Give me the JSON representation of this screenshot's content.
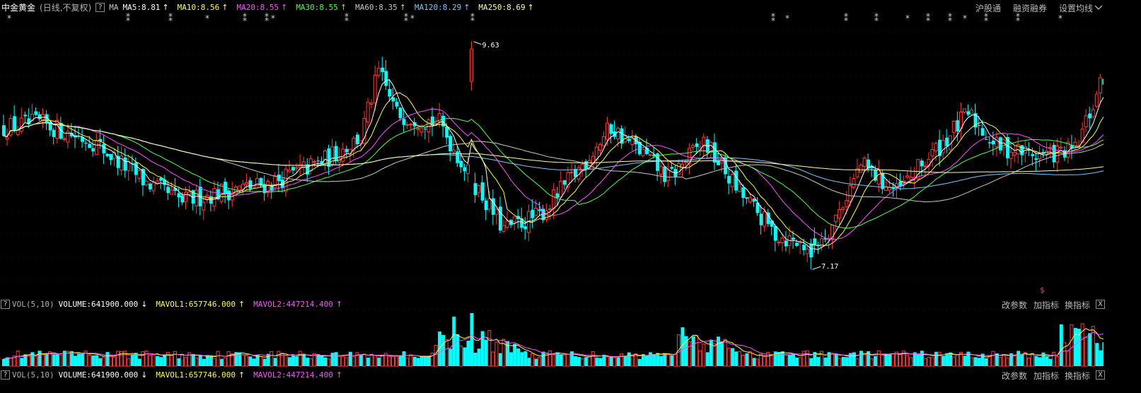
{
  "header": {
    "stock_name": "中金黄金",
    "period_info": "(日线,不复权)",
    "help_label": "?",
    "indicator": "MA",
    "ma_items": [
      {
        "label": "MA5:8.81",
        "arrow": "↑",
        "color": "#ffffff"
      },
      {
        "label": "MA10:8.56",
        "arrow": "↑",
        "color": "#ffff4f"
      },
      {
        "label": "MA20:8.55",
        "arrow": "↑",
        "color": "#ff55ff"
      },
      {
        "label": "MA30:8.55",
        "arrow": "↑",
        "color": "#55ff55"
      },
      {
        "label": "MA60:8.35",
        "arrow": "↑",
        "color": "#c8c8c8"
      },
      {
        "label": "MA120:8.29",
        "arrow": "↑",
        "color": "#7ec8ff"
      },
      {
        "label": "MA250:8.69",
        "arrow": "↑",
        "color": "#ffffaa"
      }
    ],
    "buttons": [
      "沪股通",
      "融资融券",
      "设置均线"
    ]
  },
  "price_chart": {
    "high_label": "9.63",
    "low_label": "7.17",
    "marker_label": "$"
  },
  "vol_panel": {
    "indicator": "VOL(5,10)",
    "volume": "VOLUME:641900.000",
    "volume_arrow": "↓",
    "mavol1": "MAVOL1:657746.000",
    "mavol1_arrow": "↑",
    "mavol2": "MAVOL2:447214.400",
    "mavol2_arrow": "↑",
    "buttons": [
      "改参数",
      "加指标",
      "换指标"
    ],
    "close_label": "X",
    "help_label": "?"
  },
  "chart_data": {
    "type": "candlestick",
    "price_range_shown": [
      7.17,
      9.63
    ],
    "ma_lines": [
      "MA5",
      "MA10",
      "MA20",
      "MA30",
      "MA60",
      "MA120",
      "MA250"
    ],
    "last_values": {
      "MA5": 8.81,
      "MA10": 8.56,
      "MA20": 8.55,
      "MA30": 8.55,
      "MA60": 8.35,
      "MA120": 8.29,
      "MA250": 8.69
    },
    "volume_last": 641900,
    "mavol1_last": 657746,
    "mavol2_last": 447214.4
  },
  "colors": {
    "up": "#ff3b3b",
    "down": "#00ffff",
    "background": "#000000",
    "grid": "#3a0000"
  }
}
